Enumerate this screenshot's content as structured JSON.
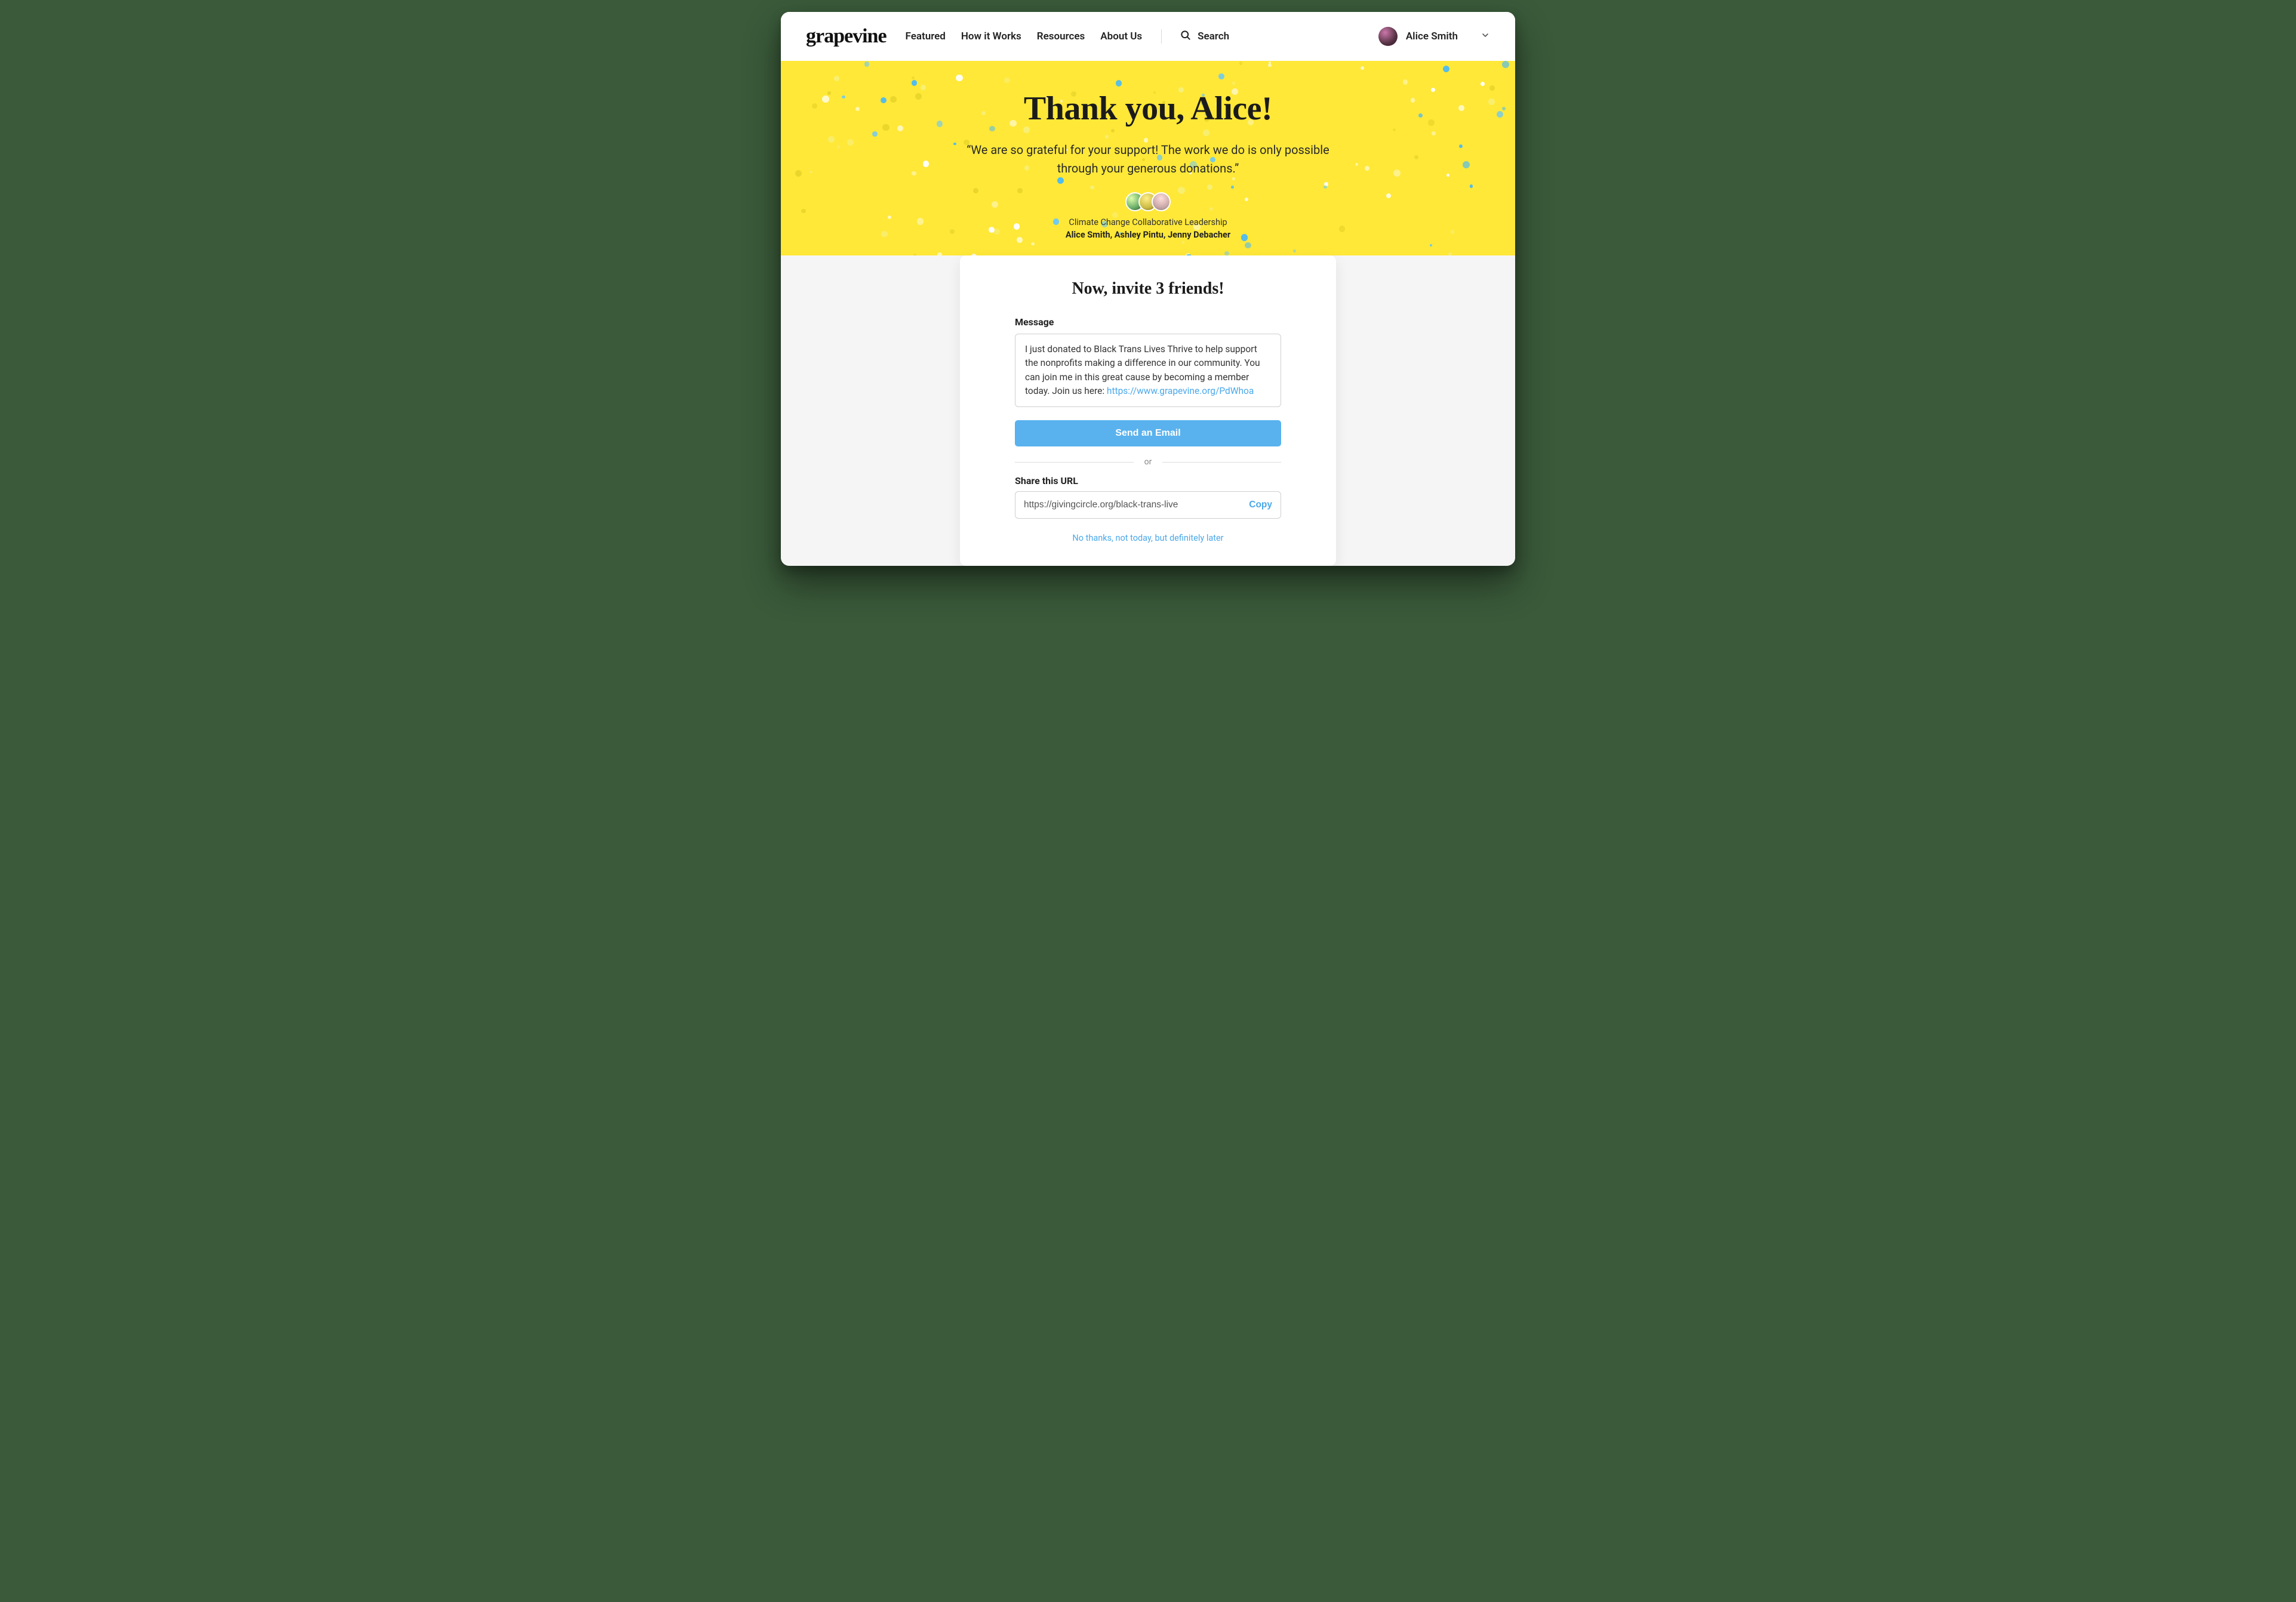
{
  "brand": "grapevine",
  "nav": {
    "featured": "Featured",
    "how_it_works": "How it Works",
    "resources": "Resources",
    "about_us": "About Us",
    "search": "Search"
  },
  "user": {
    "name": "Alice Smith"
  },
  "hero": {
    "title": "Thank you, Alice!",
    "quote": "“We are so grateful for your support! The work we do is only possible through your generous donations.”",
    "org": "Climate Change Collaborative Leadership",
    "leaders": "Alice Smith, Ashley Pintu,  Jenny Debacher"
  },
  "card": {
    "title": "Now, invite 3 friends!",
    "message_label": "Message",
    "message_text": "I just donated to Black Trans Lives Thrive to help support the nonprofits making a difference in our community. You can join me in this great cause by becoming a member today. Join us here:  ",
    "message_link": "https://www.grapevine.org/PdWhoa",
    "send_label": "Send an Email",
    "or": "or",
    "share_label": "Share this URL",
    "share_url": "https://givingcircle.org/black-trans-live",
    "copy": "Copy",
    "skip": "No thanks, not today, but definitely later"
  },
  "colors": {
    "accent_yellow": "#ffe838",
    "accent_blue": "#59b2ed",
    "link_blue": "#4aa8ea"
  }
}
